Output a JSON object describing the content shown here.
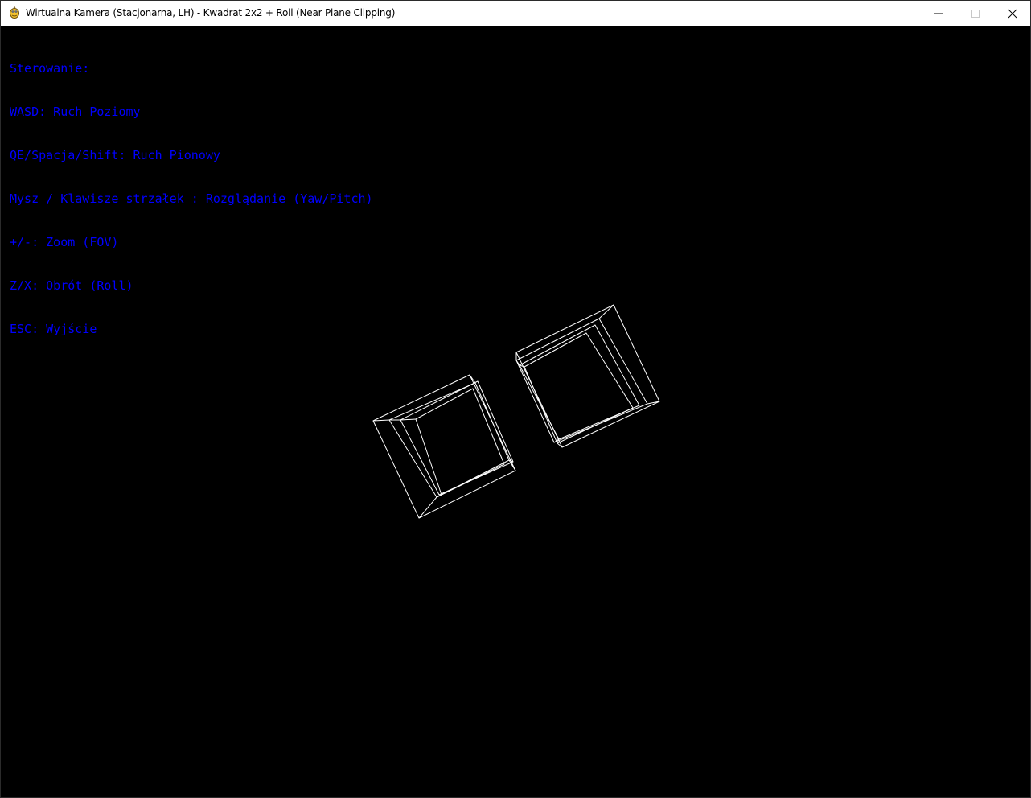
{
  "window": {
    "title": "Wirtualna Kamera (Stacjonarna, LH) - Kwadrat 2x2 + Roll (Near Plane Clipping)",
    "icon": "pygame-snake-icon",
    "controls": [
      "minimize-icon",
      "maximize-icon",
      "close-icon"
    ]
  },
  "hud": {
    "heading": "Sterowanie:",
    "lines": [
      "WASD: Ruch Poziomy",
      "QE/Spacja/Shift: Ruch Pionowy",
      "Mysz / Klawisze strzałek : Rozglądanie (Yaw/Pitch)",
      "+/-: Zoom (FOV)",
      "Z/X: Obrót (Roll)",
      "ESC: Wyjście"
    ],
    "color": "#0000ff"
  },
  "scene": {
    "background": "#000000",
    "wireframe_color": "#ffffff",
    "objects": [
      "wireframe-box-left",
      "wireframe-box-right"
    ]
  }
}
